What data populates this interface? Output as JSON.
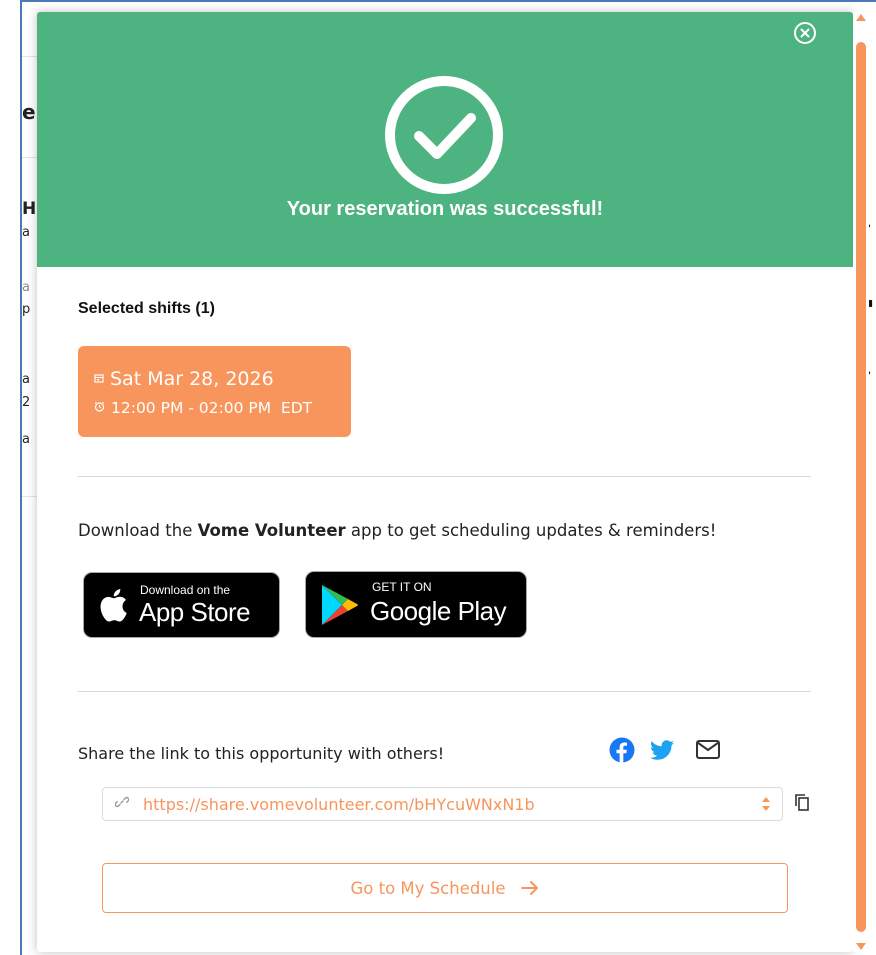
{
  "header": {
    "title": "Your reservation was successful!",
    "close_icon": "close-circle-icon",
    "success_icon": "check-circle-icon",
    "background_color": "#4db380"
  },
  "shifts": {
    "label": "Selected shifts (1)",
    "items": [
      {
        "date": "Sat Mar 28, 2026",
        "time": "12:00 PM - 02:00 PM  EDT"
      }
    ],
    "card_color": "#f7955c"
  },
  "download": {
    "prefix": "Download the ",
    "app_name": "Vome Volunteer",
    "suffix": " app to get scheduling updates & reminders!",
    "appstore_small": "Download on the",
    "appstore_big": "App Store",
    "googleplay_small": "GET IT ON",
    "googleplay_big": "Google Play"
  },
  "share": {
    "label": "Share the link to this opportunity with others!",
    "icons": [
      "facebook-icon",
      "twitter-icon",
      "mail-icon"
    ],
    "link": "https://share.vomevolunteer.com/bHYcuWNxN1b"
  },
  "actions": {
    "go_label": "Go to My Schedule"
  },
  "accent_color": "#f7955c"
}
